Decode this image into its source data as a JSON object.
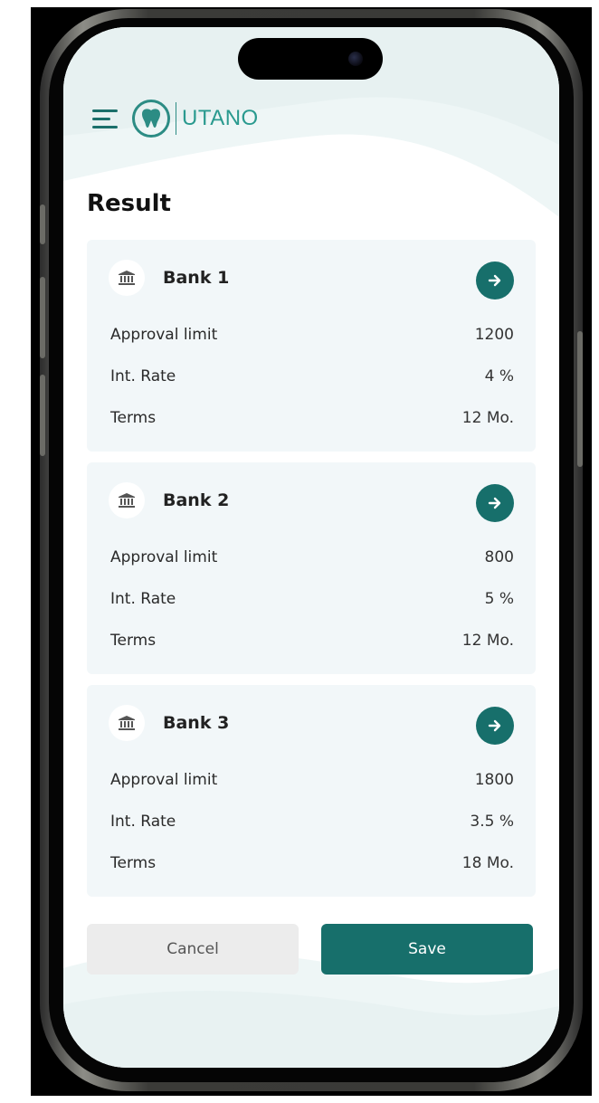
{
  "app": {
    "logo_text": "UTANO"
  },
  "page": {
    "title": "Result"
  },
  "labels": {
    "approval_limit": "Approval limit",
    "int_rate": "Int. Rate",
    "terms": "Terms"
  },
  "banks": [
    {
      "name": "Bank 1",
      "approval_limit": "1200",
      "int_rate": "4 %",
      "terms": "12 Mo."
    },
    {
      "name": "Bank 2",
      "approval_limit": "800",
      "int_rate": "5 %",
      "terms": "12 Mo."
    },
    {
      "name": "Bank 3",
      "approval_limit": "1800",
      "int_rate": "3.5 %",
      "terms": "18 Mo."
    }
  ],
  "actions": {
    "cancel_label": "Cancel",
    "save_label": "Save"
  },
  "icons": {
    "menu": "hamburger-menu-icon",
    "logo": "tooth-logo-icon",
    "bank": "bank-icon",
    "go": "arrow-right-icon"
  },
  "colors": {
    "accent": "#176f6b",
    "logo": "#2a9a8f",
    "card_bg": "#f2f7f9",
    "cancel_bg": "#ececec"
  }
}
